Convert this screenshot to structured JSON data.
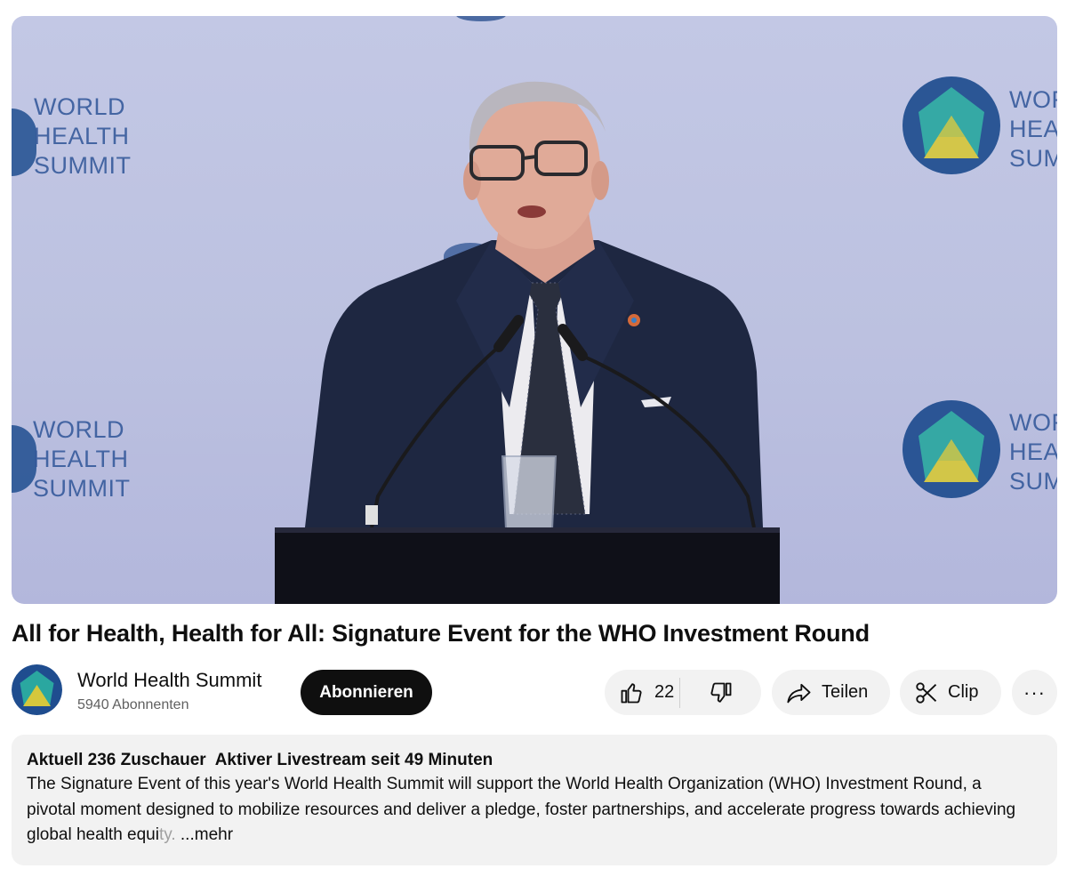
{
  "video": {
    "watermark_lines": [
      "WORLD",
      "HEALTH",
      "SUMMIT"
    ],
    "watermark_lines_cropped": [
      "WOR",
      "HEA",
      "SUM"
    ]
  },
  "title": "All for Health, Health for All: Signature Event for the WHO Investment Round",
  "channel": {
    "name": "World Health Summit",
    "subscribers": "5940 Abonnenten",
    "subscribe_label": "Abonnieren"
  },
  "actions": {
    "like_count": "22",
    "share_label": "Teilen",
    "clip_label": "Clip",
    "more_label": "···"
  },
  "description": {
    "viewers": "Aktuell 236 Zuschauer",
    "live_status": "Aktiver Livestream seit 49 Minuten",
    "text": "The Signature Event of this year's World Health Summit will support the World Health Organization (WHO) Investment Round, a pivotal moment designed to mobilize resources and deliver a pledge, foster partnerships, and accelerate progress towards achieving global health equi",
    "text_faded": "ty.",
    "more_label": "...mehr"
  },
  "colors": {
    "brand_blue": "#1f4d8f",
    "logo_teal": "#2aa7a0",
    "logo_yellow": "#d5c73c",
    "subscribe_bg": "#0f0f0f",
    "pill_bg": "#f2f2f2"
  },
  "icons": [
    "thumbs-up-icon",
    "thumbs-down-icon",
    "share-arrow-icon",
    "scissors-icon",
    "more-horizontal-icon"
  ]
}
